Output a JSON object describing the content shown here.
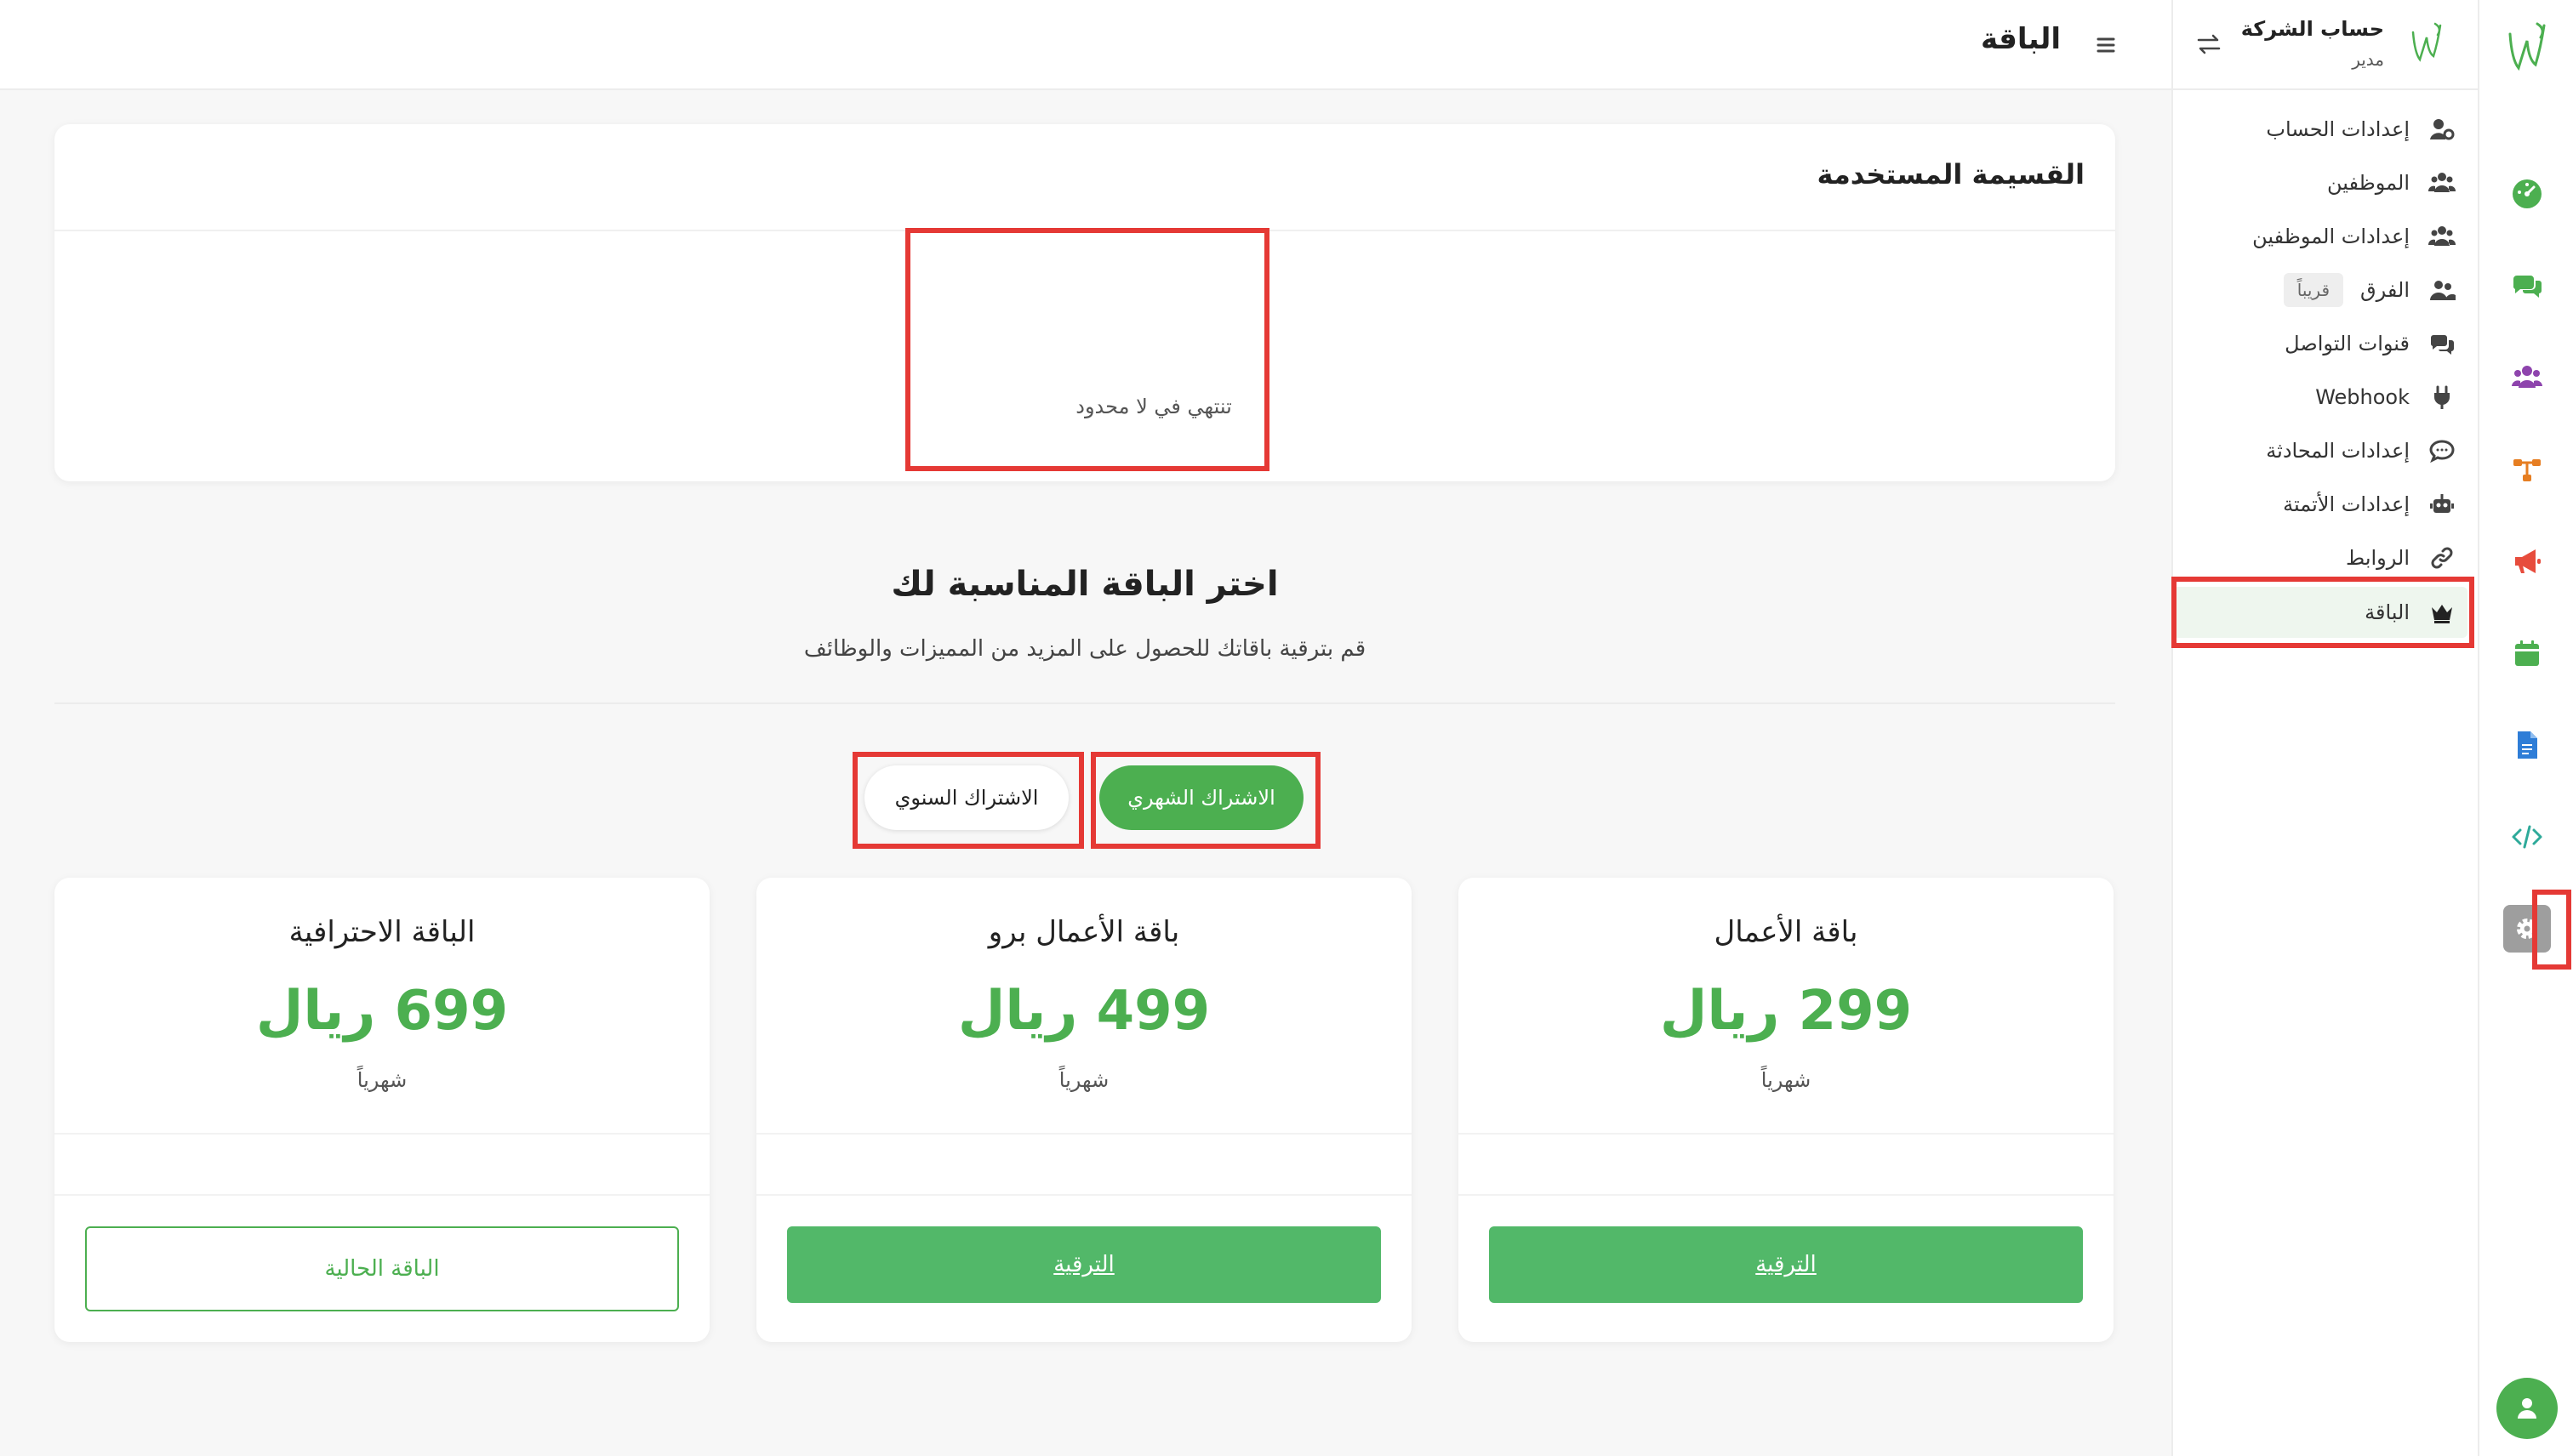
{
  "colors": {
    "accent": "#4caf50",
    "highlight": "#e53935",
    "upgrade_button": "#52b869"
  },
  "header": {
    "title": "الباقة",
    "menu_icon": "hamburger-icon"
  },
  "sidebar": {
    "company_name": "حساب الشركة",
    "role": "مدير",
    "switch_icon": "swap-arrows-icon",
    "items": [
      {
        "label": "إعدادات الحساب",
        "icon": "user-gear-icon"
      },
      {
        "label": "الموظفين",
        "icon": "users-icon"
      },
      {
        "label": "إعدادات الموظفين",
        "icon": "users-gear-icon"
      },
      {
        "label": "الفرق",
        "icon": "team-icon",
        "badge": "قريباً"
      },
      {
        "label": "قنوات التواصل",
        "icon": "chat-bubbles-icon"
      },
      {
        "label": "Webhook",
        "icon": "plug-icon"
      },
      {
        "label": "إعدادات المحادثة",
        "icon": "comment-icon"
      },
      {
        "label": "إعدادات الأتمتة",
        "icon": "robot-icon"
      },
      {
        "label": "الروابط",
        "icon": "link-icon"
      },
      {
        "label": "الباقة",
        "icon": "crown-icon",
        "active": true
      }
    ]
  },
  "rail": {
    "items": [
      "dashboard-icon",
      "chat-icon",
      "users-icon",
      "flow-icon",
      "megaphone-icon",
      "calendar-icon",
      "document-icon",
      "code-icon",
      "settings-icon"
    ],
    "active": "settings-icon",
    "avatar_icon": "user-icon"
  },
  "usage": {
    "title": "القسيمة المستخدمة",
    "expiry": "تنتهي في لا محدود"
  },
  "plans_section": {
    "title": "اختر الباقة المناسبة لك",
    "subtitle": "قم بترقية باقاتك للحصول على المزيد من المميزات والوظائف",
    "toggle_monthly": "الاشتراك الشهري",
    "toggle_yearly": "الاشتراك السنوي",
    "selected": "monthly"
  },
  "plans": [
    {
      "name": "باقة الأعمال",
      "price": "299 ريال",
      "period": "شهرياً",
      "button": "الترقية",
      "current": false
    },
    {
      "name": "باقة الأعمال برو",
      "price": "499 ريال",
      "period": "شهرياً",
      "button": "الترقية",
      "current": false
    },
    {
      "name": "الباقة الاحترافية",
      "price": "699 ريال",
      "period": "شهرياً",
      "button": "الباقة الحالية",
      "current": true
    }
  ]
}
